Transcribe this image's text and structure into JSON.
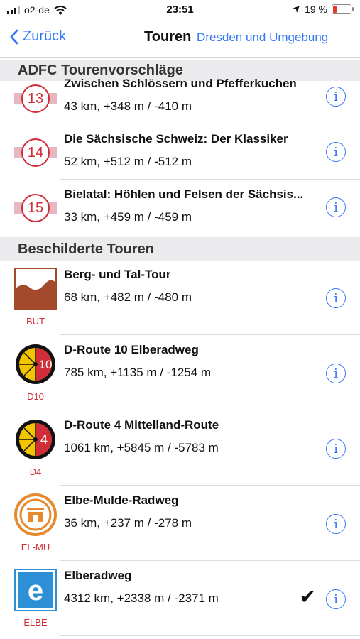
{
  "status": {
    "carrier": "o2-de",
    "time": "23:51",
    "battery_pct": "19 %",
    "battery_level": 0.19
  },
  "nav": {
    "back_label": "Zurück",
    "title": "Touren",
    "right_label": "Dresden und Umgebung"
  },
  "sections": {
    "adfc": "ADFC Tourenvorschläge",
    "signed": "Beschilderte Touren"
  },
  "adfc_items": [
    {
      "number": "13",
      "title": "Zwischen Schlössern und Pfefferkuchen",
      "stats": "43 km, +348 m / -410 m"
    },
    {
      "number": "14",
      "title": "Die Sächsische Schweiz: Der Klassiker",
      "stats": "52 km, +512 m / -512 m"
    },
    {
      "number": "15",
      "title": "Bielatal: Höhlen und Felsen der Sächsis...",
      "stats": "33 km, +459 m / -459 m"
    }
  ],
  "signed_items": [
    {
      "code": "BUT",
      "title": "Berg- und Tal-Tour",
      "stats": "68 km, +482 m / -480 m",
      "logo_text": ""
    },
    {
      "code": "D10",
      "title": "D-Route 10 Elberadweg",
      "stats": "785 km, +1135 m / -1254 m",
      "logo_text": "10"
    },
    {
      "code": "D4",
      "title": "D-Route 4 Mittelland-Route",
      "stats": "1061 km, +5845 m / -5783 m",
      "logo_text": "4"
    },
    {
      "code": "EL-MU",
      "title": "Elbe-Mulde-Radweg",
      "stats": "36 km, +237 m / -278 m",
      "logo_text": ""
    },
    {
      "code": "ELBE",
      "title": "Elberadweg",
      "stats": "4312 km, +2338 m / -2371 m",
      "logo_text": "e",
      "selected": true
    }
  ],
  "colors": {
    "accent": "#3478f6",
    "badge_red": "#d22c38",
    "badge_band": "#e6b7c1",
    "section_bg": "#ebebed"
  },
  "icons": {
    "info": "i",
    "check": "✔"
  }
}
